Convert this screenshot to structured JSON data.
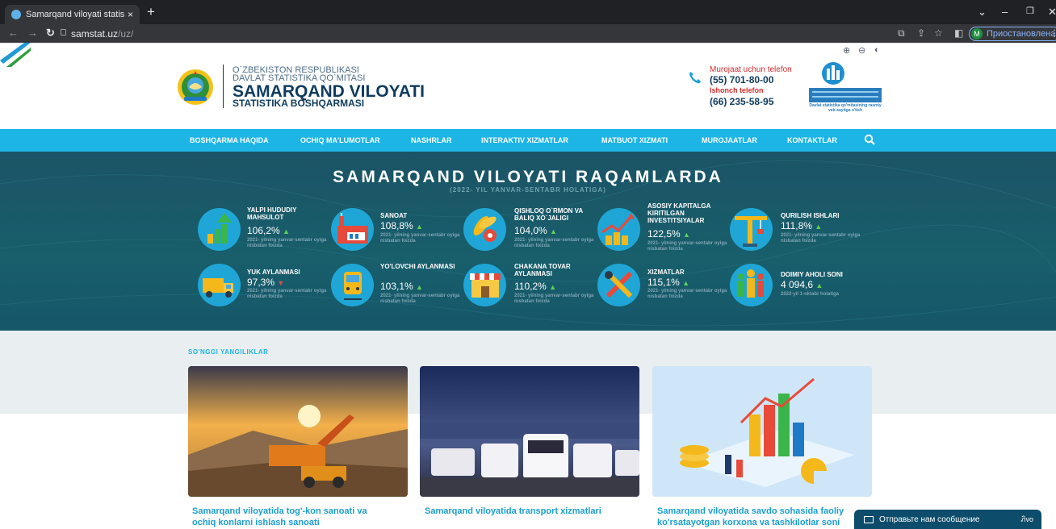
{
  "browser": {
    "tab_title": "Samarqand viloyati statistika bos",
    "url_host": "samstat.uz",
    "url_path": "/uz/",
    "profile_initial": "M",
    "profile_status": "Приостановлена",
    "new_tab": "+",
    "tab_close": "×"
  },
  "header": {
    "line1": "O`ZBEKISTON RESPUBLIKASI",
    "line2": "DAVLAT STATISTIKA QO`MITASI",
    "title": "SAMARQAND VILOYATI",
    "subtitle": "STATISTIKA BOSHQARMASI",
    "contact_label": "Murojaat uchun telefon",
    "contact_phone": "(55) 701-80-00",
    "trust_label": "Ishonch telefon",
    "trust_phone": "(66) 235-58-95",
    "portal_caption": "Davlat statistika qo'mitasining rasmiy veb-saytiga o'tish",
    "zoom_in": "⊕",
    "zoom_out": "⊖",
    "contrast": "◐"
  },
  "nav": [
    "BOSHQARMA HAQIDA",
    "OCHIQ MA'LUMOTLAR",
    "NASHRLAR",
    "INTERAKTIV XIZMATLAR",
    "MATBUOT XIZMATI",
    "MUROJAATLAR",
    "KONTAKTLAR"
  ],
  "stats": {
    "title": "SAMARQAND VILOYATI RAQAMLARDA",
    "subtitle": "(2022- YIL YANVAR-SENTABR HOLATIGA)",
    "items": [
      {
        "label": "YALPI HUDUDIY MAHSULOT",
        "value": "106,2%",
        "trend": "up",
        "note": "2021- yilning yanvar-sentabr oyiga nisbatan foizda",
        "icon": "growth-chart-icon"
      },
      {
        "label": "SANOAT",
        "value": "108,8%",
        "trend": "up",
        "note": "2021- yilning yanvar-sentabr oyiga nisbatan foizda",
        "icon": "factory-icon"
      },
      {
        "label": "QISHLOQ O`RMON VA BALIQ XO`JALIGI",
        "value": "104,0%",
        "trend": "up",
        "note": "2021- yilning yanvar-sentabr oyiga nisbatan foizda",
        "icon": "wheat-icon"
      },
      {
        "label": "ASOSIY KAPITALGA KIRITILGAN INVESTITSIYALAR",
        "value": "122,5%",
        "trend": "up",
        "note": "2021- yilning yanvar-sentabr oyiga nisbatan foizda",
        "icon": "investment-icon"
      },
      {
        "label": "QURILISH ISHLARI",
        "value": "111,8%",
        "trend": "up",
        "note": "2021- yilning yanvar-sentabr oyiga nisbatan foizda",
        "icon": "crane-icon"
      },
      {
        "label": "YUK AYLANMASI",
        "value": "97,3%",
        "trend": "down",
        "note": "2021- yilning yanvar-sentabr oyiga nisbatan foizda",
        "icon": "truck-icon"
      },
      {
        "label": "YO'LOVCHI AYLANMASI",
        "value": "103,1%",
        "trend": "up",
        "note": "2021- yilning yanvar-sentabr oyiga nisbatan foizda",
        "icon": "train-icon"
      },
      {
        "label": "CHAKANA TOVAR AYLANMASI",
        "value": "110,2%",
        "trend": "up",
        "note": "2021- yilning yanvar-sentabr oyiga nisbatan foizda",
        "icon": "shop-icon"
      },
      {
        "label": "XIZMATLAR",
        "value": "115,1%",
        "trend": "up",
        "note": "2021- yilning yanvar-sentabr oyiga nisbatan foizda",
        "icon": "tools-icon"
      },
      {
        "label": "DOIMIY AHOLI SONI",
        "value": "4 094,6",
        "trend": "up",
        "note": "2022-yil 1-oktabr holatiga",
        "icon": "population-icon"
      }
    ]
  },
  "news": {
    "section_title": "SO'NGGI YANGILIKLAR",
    "items": [
      {
        "title": "Samarqand viloyatida tog'-kon sanoati va",
        "title2": "ochiq konlarni ishlash sanoati"
      },
      {
        "title": "Samarqand viloyatida transport xizmatlari",
        "title2": ""
      },
      {
        "title": "Samarqand viloyatida savdo sohasida faoliy",
        "title2": "ko'rsatayotgan korxona va tashkilotlar soni"
      }
    ]
  },
  "chat": {
    "label": "Отправьте нам сообщение",
    "tail": "ภิvo"
  },
  "colors": {
    "nav": "#1db5e6",
    "stats_bg": "#1a5d6a",
    "brand_navy": "#0e3b5e",
    "accent_red": "#d12b2b",
    "up": "#5fd15a",
    "down": "#e04a4a"
  }
}
